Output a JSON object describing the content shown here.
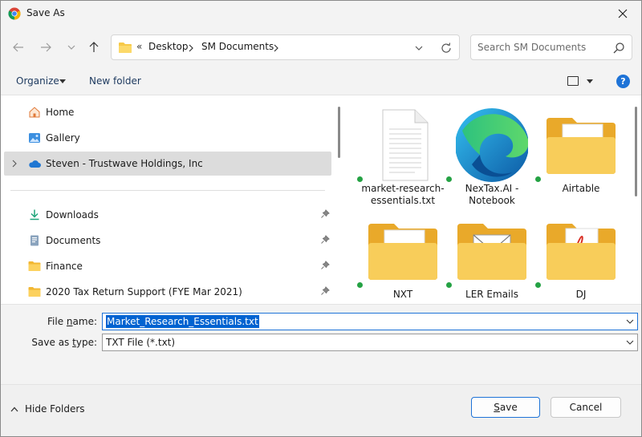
{
  "window": {
    "title": "Save As"
  },
  "address": {
    "overflow": "«",
    "crumbs": [
      "Desktop",
      "SM Documents"
    ]
  },
  "search": {
    "placeholder": "Search SM Documents"
  },
  "toolbar": {
    "organize": "Organize",
    "new_folder": "New folder",
    "help": "?"
  },
  "nav": {
    "items": [
      {
        "label": "Home",
        "icon": "home-icon"
      },
      {
        "label": "Gallery",
        "icon": "gallery-icon"
      },
      {
        "label": "Steven - Trustwave Holdings, Inc",
        "icon": "onedrive-cloud-icon",
        "selected": true
      },
      {
        "label": "Downloads",
        "icon": "download-icon",
        "pinned": true
      },
      {
        "label": "Documents",
        "icon": "documents-icon",
        "pinned": true
      },
      {
        "label": "Finance",
        "icon": "folder-icon",
        "pinned": true
      },
      {
        "label": "2020 Tax Return Support (FYE Mar 2021)",
        "icon": "folder-icon",
        "pinned": true
      }
    ]
  },
  "files": [
    {
      "name": "market-research-essentials.txt",
      "lines": [
        "market-research-",
        "essentials.txt"
      ],
      "icon": "text-file-icon",
      "synced": true
    },
    {
      "name": "NexTax.AI - Notebook",
      "lines": [
        "NexTax.AI -",
        "Notebook"
      ],
      "icon": "edge-browser-icon",
      "synced": true
    },
    {
      "name": "Airtable",
      "lines": [
        "Airtable"
      ],
      "icon": "folder-word-icon",
      "synced": true
    },
    {
      "name": "NXT",
      "lines": [
        "NXT"
      ],
      "icon": "folder-word-icon",
      "synced": true
    },
    {
      "name": "LER Emails",
      "lines": [
        "LER Emails"
      ],
      "icon": "folder-mail-icon",
      "synced": true
    },
    {
      "name": "DJ",
      "lines": [
        "DJ"
      ],
      "icon": "folder-pdf-icon",
      "synced": true
    }
  ],
  "form": {
    "file_name_label_pre": "File ",
    "file_name_label_key": "n",
    "file_name_label_post": "ame:",
    "file_name_value": "Market_Research_Essentials.txt",
    "save_type_label_pre": "Save as ",
    "save_type_label_key": "t",
    "save_type_label_post": "ype:",
    "save_type_value": "TXT File (*.txt)"
  },
  "footer": {
    "hide_folders": "Hide Folders",
    "save_key": "S",
    "save_rest": "ave",
    "cancel": "Cancel"
  },
  "colors": {
    "accent": "#1e73d7",
    "selection": "#0063d1",
    "folder": "#f7c948",
    "sync_green": "#25a244"
  }
}
